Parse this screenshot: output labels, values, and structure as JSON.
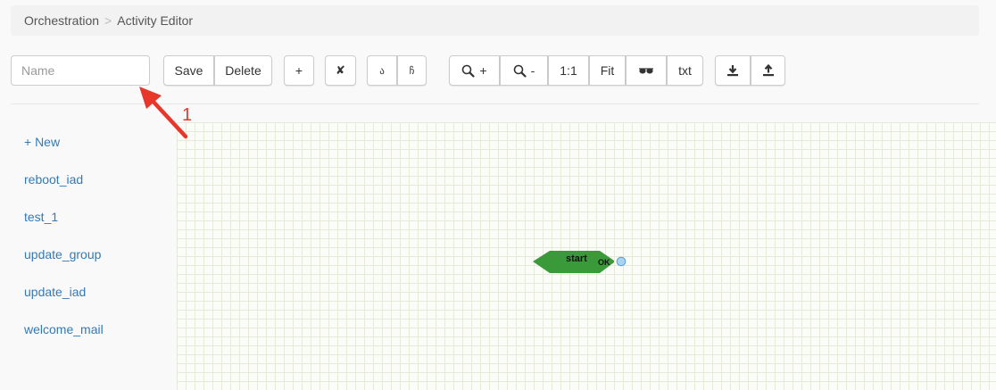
{
  "breadcrumb": {
    "root": "Orchestration",
    "separator": ">",
    "current": "Activity Editor"
  },
  "toolbar": {
    "name_placeholder": "Name",
    "save_label": "Save",
    "delete_label": "Delete",
    "add_label": "+",
    "remove_label": "✘",
    "undo_label": "ა",
    "redo_label": "ჩ",
    "zoom_in_label": "+",
    "zoom_out_label": "-",
    "actual_size_label": "1:1",
    "fit_label": "Fit",
    "preview_icon": "glasses-icon",
    "txt_label": "txt",
    "download_icon": "download-icon",
    "upload_icon": "upload-icon"
  },
  "sidebar": {
    "items": [
      {
        "label": "+ New"
      },
      {
        "label": "reboot_iad"
      },
      {
        "label": "test_1"
      },
      {
        "label": "update_group"
      },
      {
        "label": "update_iad"
      },
      {
        "label": "welcome_mail"
      }
    ]
  },
  "canvas": {
    "node": {
      "label": "start",
      "port_label": "OK",
      "color": "#3a9a3a",
      "port_color": "#a9d4f5"
    }
  },
  "annotation": {
    "number": "1",
    "color": "#e8362b"
  }
}
